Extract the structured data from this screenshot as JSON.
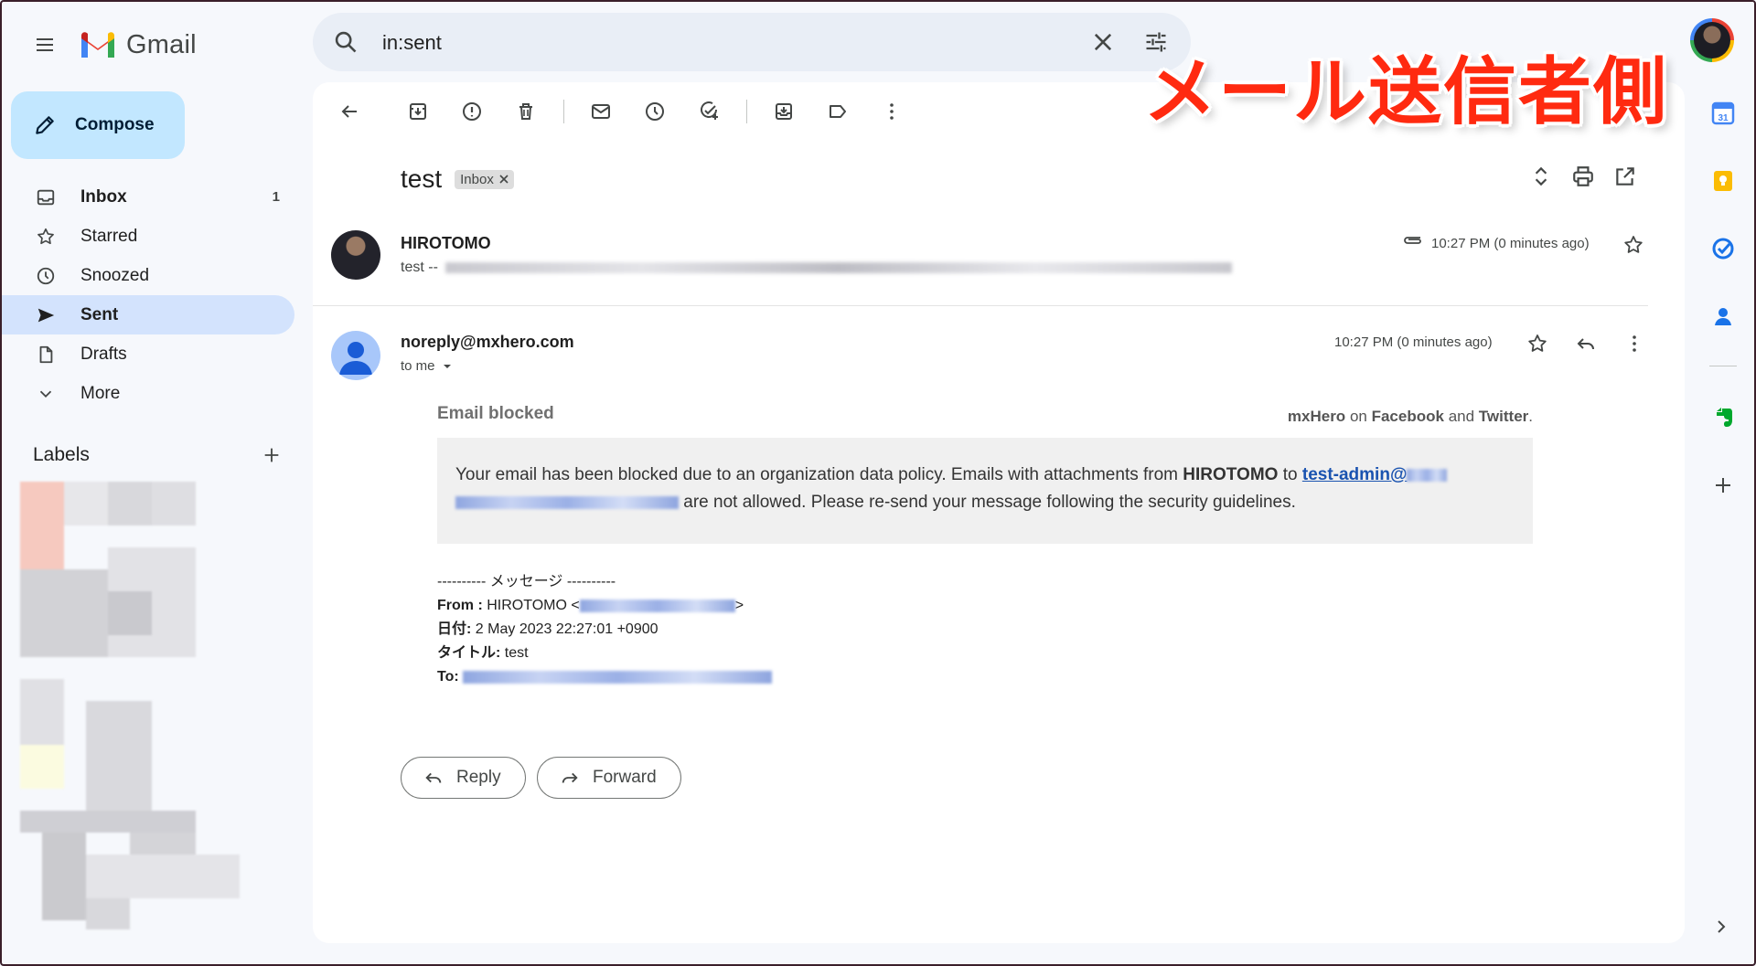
{
  "app": {
    "name": "Gmail"
  },
  "search": {
    "value": "in:sent"
  },
  "compose": {
    "label": "Compose"
  },
  "nav": [
    {
      "label": "Inbox",
      "count": "1",
      "icon": "inbox-icon"
    },
    {
      "label": "Starred",
      "count": "",
      "icon": "star-icon"
    },
    {
      "label": "Snoozed",
      "count": "",
      "icon": "clock-icon"
    },
    {
      "label": "Sent",
      "count": "",
      "icon": "send-icon"
    },
    {
      "label": "Drafts",
      "count": "",
      "icon": "draft-icon"
    },
    {
      "label": "More",
      "count": "",
      "icon": "chevron-down-icon"
    }
  ],
  "labels": {
    "title": "Labels"
  },
  "thread": {
    "subject": "test",
    "label_chip": "Inbox",
    "messages": [
      {
        "sender": "HIROTOMO",
        "snippet_prefix": "test --",
        "time": "10:27 PM (0 minutes ago)"
      },
      {
        "sender": "noreply@mxhero.com",
        "recipient": "to me",
        "time": "10:27 PM (0 minutes ago)"
      }
    ]
  },
  "email_body": {
    "title": "Email blocked",
    "social": {
      "brand": "mxHero",
      "on": "on",
      "facebook": "Facebook",
      "and": "and",
      "twitter": "Twitter",
      "period": "."
    },
    "notice": {
      "part1": "Your email has been blocked due to an organization data policy. Emails with attachments from",
      "sender": "HIROTOMO",
      "to": "to",
      "link": "test-admin@",
      "part2": "are not allowed. Please re-send your message following the security guidelines."
    },
    "forwarded": {
      "header": "---------- メッセージ ----------",
      "from_label": "From :",
      "from_value": "HIROTOMO <",
      "from_close": ">",
      "date_label": "日付:",
      "date_value": "2 May 2023 22:27:01 +0900",
      "title_label": "タイトル:",
      "title_value": "test",
      "to_label": "To:"
    }
  },
  "actions": {
    "reply": "Reply",
    "forward": "Forward"
  },
  "overlay_caption": "メール送信者側",
  "colors": {
    "accent": "#0b57d0",
    "sent_highlight": "#d3e3fd",
    "compose_bg": "#c2e7ff",
    "overlay_red": "#ff2a10"
  }
}
